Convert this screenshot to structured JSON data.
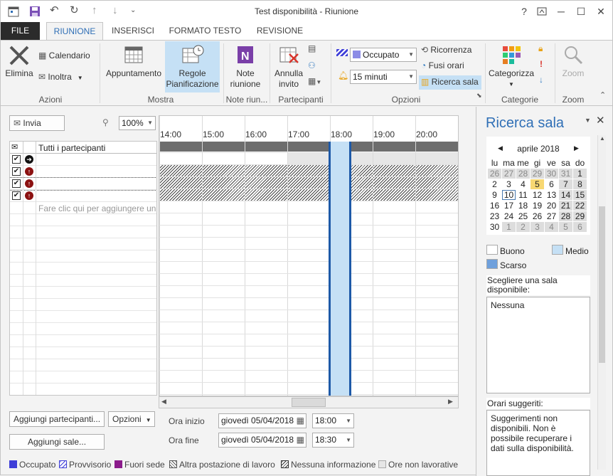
{
  "window": {
    "title": "Test disponibilità - Riunione",
    "help": "?",
    "restore_icon": "restore-icon",
    "minimize": "─",
    "maximize": "☐",
    "close": "✕"
  },
  "tabs": [
    "FILE",
    "RIUNIONE",
    "INSERISCI",
    "FORMATO TESTO",
    "REVISIONE"
  ],
  "ribbon": {
    "azioni": {
      "label": "Azioni",
      "elimina": "Elimina",
      "calendario": "Calendario",
      "inoltra": "Inoltra"
    },
    "mostra": {
      "label": "Mostra",
      "appuntamento": "Appuntamento",
      "regole1": "Regole",
      "regole2": "Pianificazione"
    },
    "note": {
      "label": "Note riun...",
      "note1": "Note",
      "note2": "riunione"
    },
    "partecipanti": {
      "label": "Partecipanti",
      "annulla1": "Annulla",
      "annulla2": "invito"
    },
    "opzioni": {
      "label": "Opzioni",
      "occupato": "Occupato",
      "promemoria": "15 minuti",
      "ricorrenza": "Ricorrenza",
      "fusi": "Fusi orari",
      "ricerca_sala": "Ricerca sala"
    },
    "categorie": {
      "label": "Categorie",
      "categorizza": "Categorizza"
    },
    "zoom": {
      "label": "Zoom",
      "zoom": "Zoom"
    }
  },
  "scheduling": {
    "invia": "Invia",
    "zoom_value": "100%",
    "header": "Tutti i partecipanti",
    "add_placeholder": "Fare clic qui per aggiungere un n",
    "hours": [
      "14:00",
      "15:00",
      "16:00",
      "17:00",
      "18:00",
      "19:00",
      "20:00"
    ],
    "meeting_start_hours": 18.0,
    "meeting_end_hours": 18.5
  },
  "bottom": {
    "aggiungi_partecipanti": "Aggiungi partecipanti...",
    "opzioni": "Opzioni",
    "aggiungi_sale": "Aggiungi sale...",
    "ora_inizio_label": "Ora inizio",
    "ora_fine_label": "Ora fine",
    "start_date": "giovedì 05/04/2018",
    "start_time": "18:00",
    "end_date": "giovedì 05/04/2018",
    "end_time": "18:30"
  },
  "legend": [
    "Occupato",
    "Provvisorio",
    "Fuori sede",
    "Altra postazione di lavoro",
    "Nessuna informazione",
    "Ore non lavorative"
  ],
  "room_finder": {
    "title": "Ricerca sala",
    "month": "aprile 2018",
    "weekdays": [
      "lu",
      "ma",
      "me",
      "gi",
      "ve",
      "sa",
      "do"
    ],
    "days": [
      [
        "26",
        "27",
        "28",
        "29",
        "30",
        "31",
        "1"
      ],
      [
        "2",
        "3",
        "4",
        "5",
        "6",
        "7",
        "8"
      ],
      [
        "9",
        "10",
        "11",
        "12",
        "13",
        "14",
        "15"
      ],
      [
        "16",
        "17",
        "18",
        "19",
        "20",
        "21",
        "22"
      ],
      [
        "23",
        "24",
        "25",
        "26",
        "27",
        "28",
        "29"
      ],
      [
        "30",
        "1",
        "2",
        "3",
        "4",
        "5",
        "6"
      ]
    ],
    "legend_buono": "Buono",
    "legend_medio": "Medio",
    "legend_scarso": "Scarso",
    "choose_label": "Scegliere una sala disponibile:",
    "room_value": "Nessuna",
    "suggested_label": "Orari suggeriti:",
    "suggested_text": "Suggerimenti non disponibili. Non è possibile recuperare i dati sulla disponibilità."
  },
  "colors": {
    "accent": "#2f6fb6",
    "occupato": "#3f3fd8",
    "fuori_sede": "#8b1b8b",
    "selection": "#c5e0f5"
  }
}
